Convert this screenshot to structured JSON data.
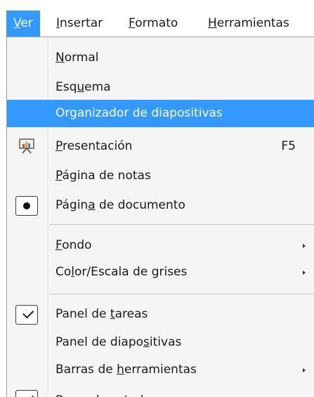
{
  "menubar": {
    "ver": "Ver",
    "insertar": "Insertar",
    "formato": "Formato",
    "herramientas": "Herramientas"
  },
  "menu": {
    "normal": "Normal",
    "esquema": "Esquema",
    "organizador": "Organizador de diapositivas",
    "presentacion": "Presentación",
    "presentacion_shortcut": "F5",
    "pagina_notas": "Página de notas",
    "pagina_documento": "Página de documento",
    "fondo": "Fondo",
    "color_escala": "Color/Escala de grises",
    "panel_tareas": "Panel de tareas",
    "panel_diapositivas": "Panel de diapositivas",
    "barras_herramientas": "Barras de herramientas",
    "barra_estado": "Barra de estado"
  },
  "colors": {
    "highlight": "#3399ff",
    "menu_background": "#f5f5f5"
  },
  "icons": {
    "presentacion": "presentation-icon",
    "pagina_documento": "radio-selected-icon",
    "panel_tareas": "checkmark-icon",
    "barra_estado": "checkmark-icon"
  }
}
